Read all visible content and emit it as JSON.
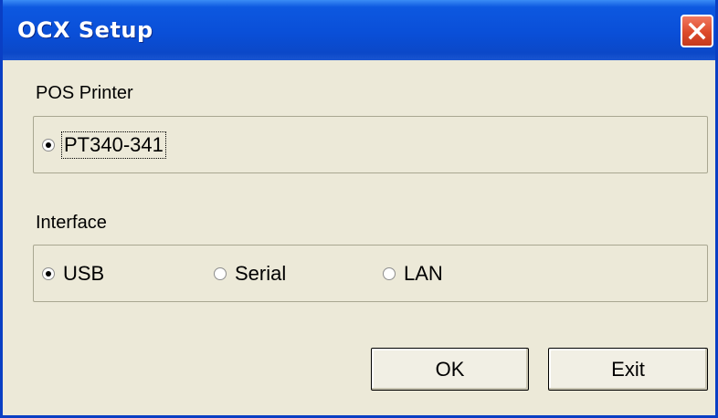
{
  "window": {
    "title": "OCX Setup"
  },
  "pos_printer": {
    "label": "POS Printer",
    "options": [
      {
        "label": "PT340-341",
        "checked": true
      }
    ]
  },
  "interface": {
    "label": "Interface",
    "options": [
      {
        "label": "USB",
        "checked": true
      },
      {
        "label": "Serial",
        "checked": false
      },
      {
        "label": "LAN",
        "checked": false
      }
    ]
  },
  "buttons": {
    "ok": "OK",
    "exit": "Exit"
  },
  "icons": {
    "close": "close-icon"
  },
  "colors": {
    "titlebar": "#0a4fd8",
    "close_button": "#dd4a2a",
    "dialog_background": "#ece9d8"
  }
}
